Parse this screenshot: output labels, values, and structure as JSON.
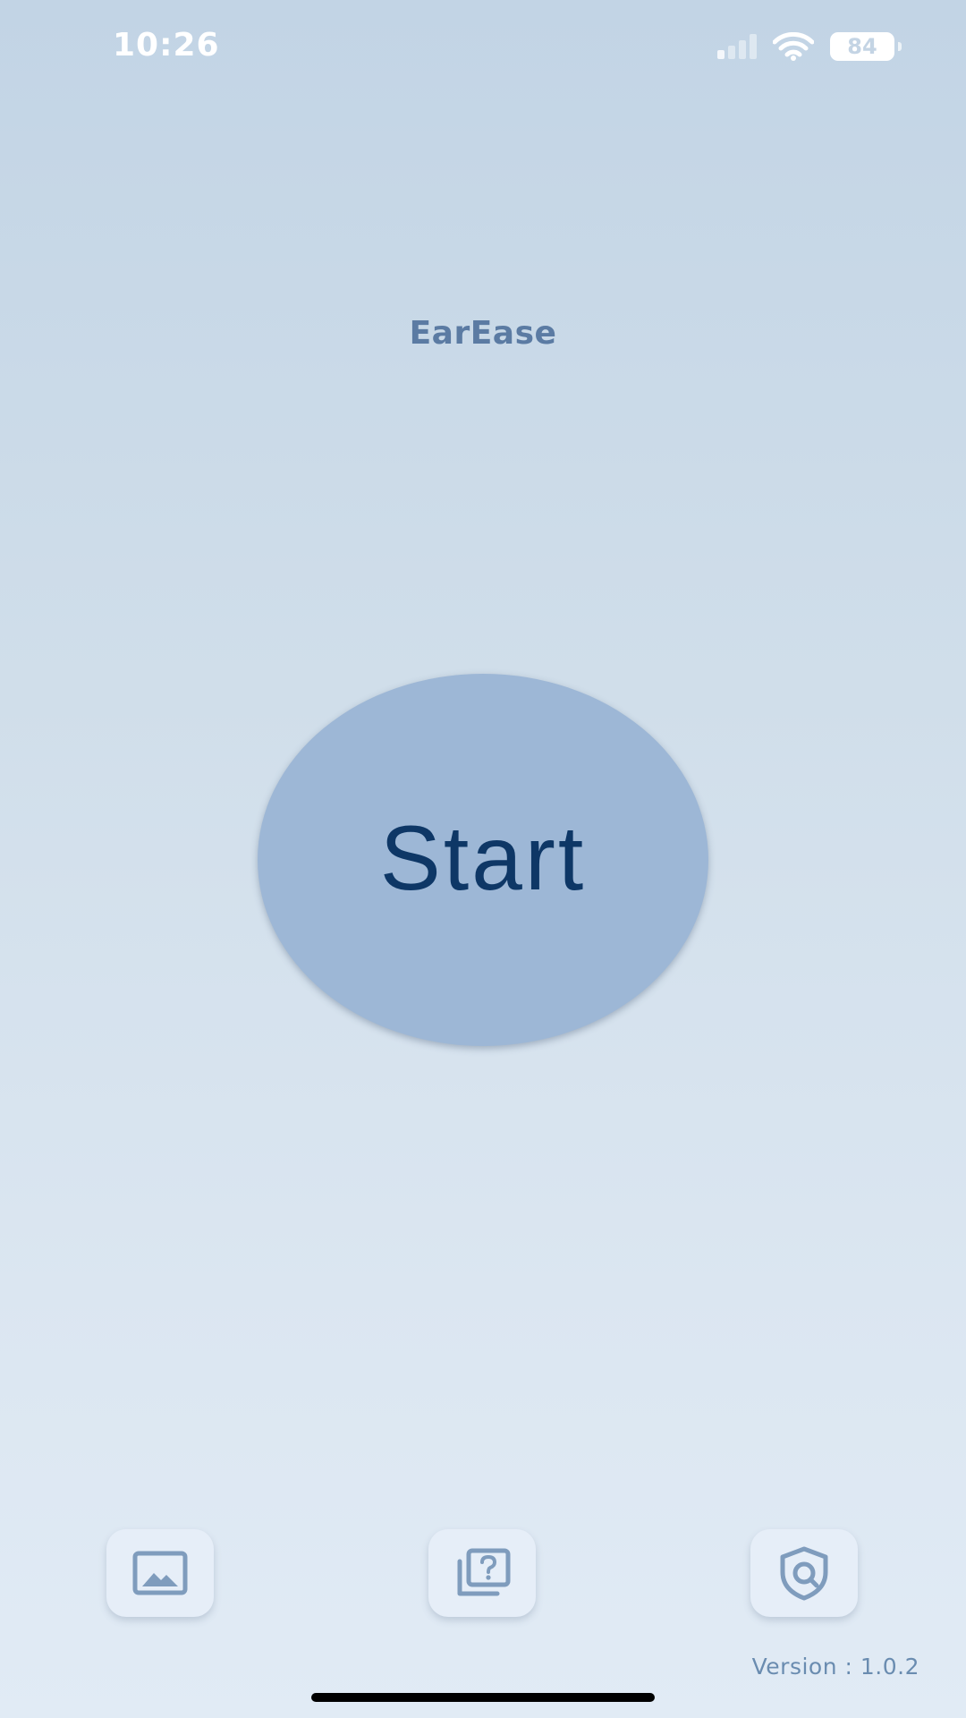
{
  "status_bar": {
    "time": "10:26",
    "battery_level": "84",
    "icons": [
      "signal-icon",
      "wifi-icon",
      "battery-icon"
    ]
  },
  "app": {
    "title": "EarEase"
  },
  "main": {
    "start_label": "Start"
  },
  "bottom_bar": {
    "buttons": [
      {
        "icon": "image-gallery-icon"
      },
      {
        "icon": "help-question-icon"
      },
      {
        "icon": "privacy-shield-icon"
      }
    ]
  },
  "footer": {
    "version": "Version : 1.0.2"
  },
  "colors": {
    "background_top": "#c2d4e5",
    "background_bottom": "#e1ebf5",
    "title": "#5b7ba3",
    "start_button": "#9db7d6",
    "start_text": "#0e3766",
    "icon": "#7f9cbd"
  }
}
